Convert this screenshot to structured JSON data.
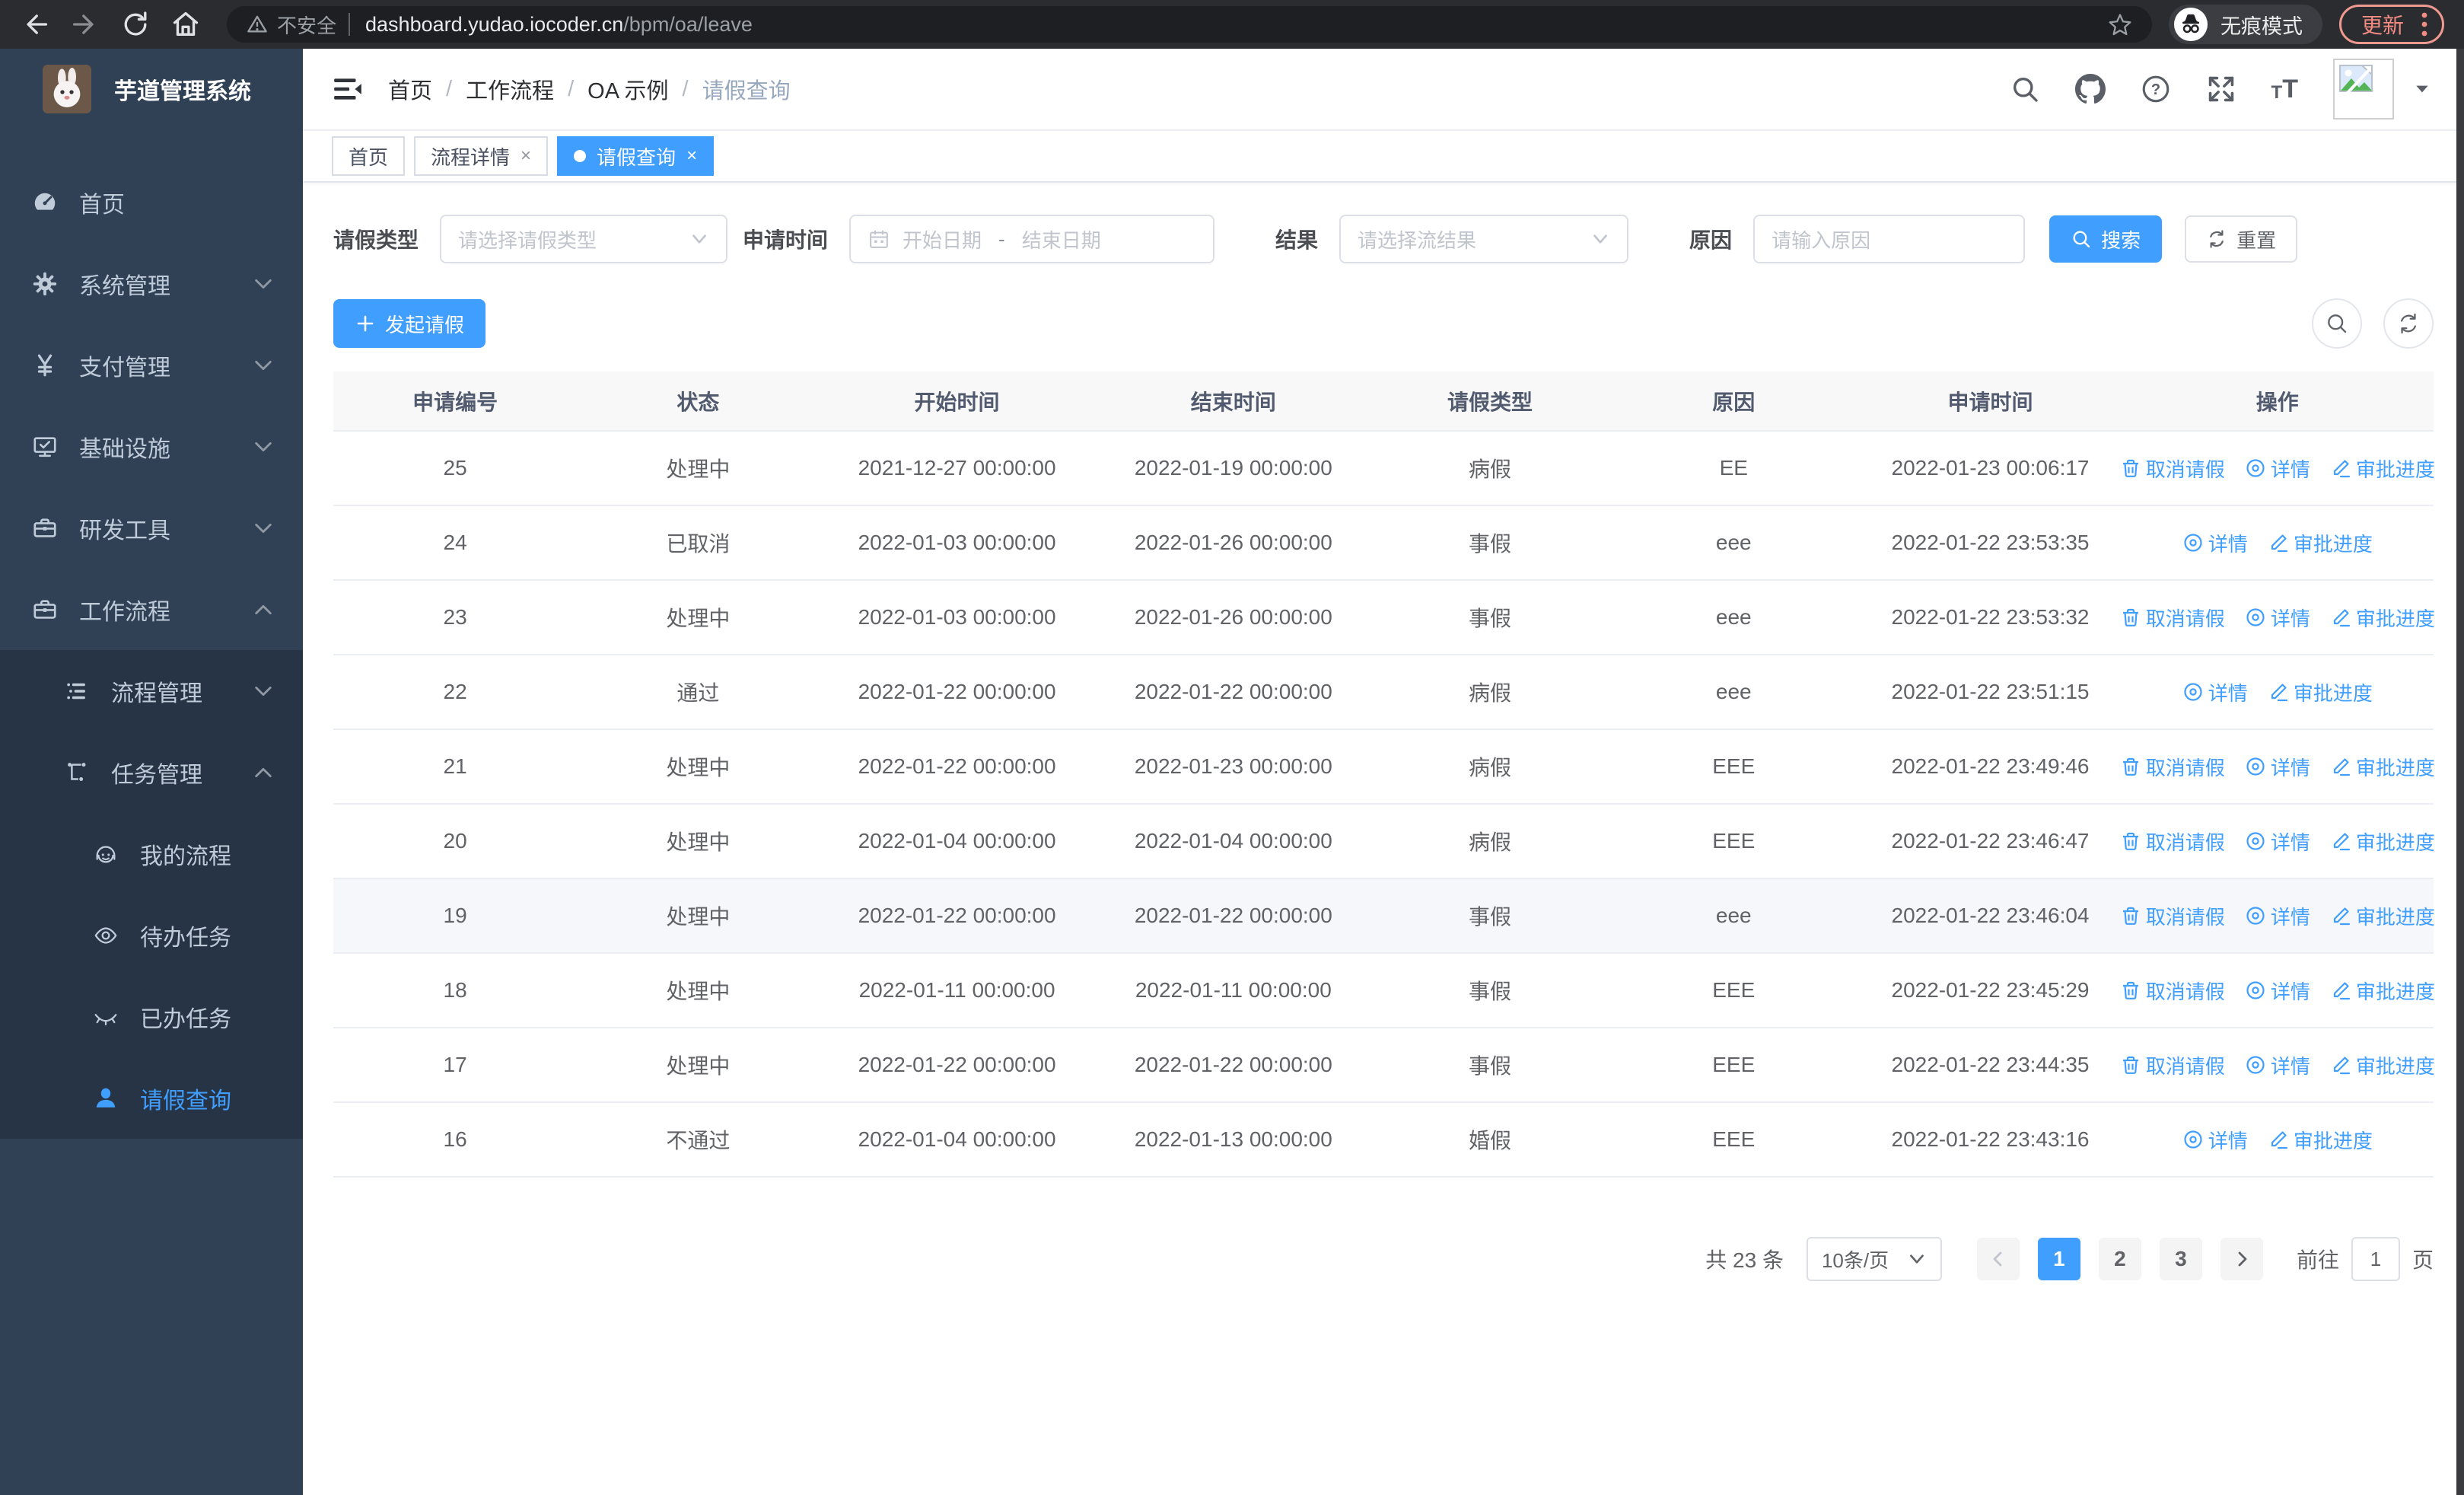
{
  "accent_color": "#409eff",
  "browser": {
    "security_label": "不安全",
    "url_host": "dashboard.yudao.iocoder.cn",
    "url_path": "/bpm/oa/leave",
    "incognito_label": "无痕模式",
    "update_label": "更新"
  },
  "sidebar": {
    "title": "芋道管理系统",
    "items": [
      {
        "label": "首页",
        "icon": "dashboard-icon",
        "level": 1,
        "chevron": "",
        "submenu": false,
        "active": false
      },
      {
        "label": "系统管理",
        "icon": "gear-icon",
        "level": 1,
        "chevron": "down",
        "submenu": false,
        "active": false
      },
      {
        "label": "支付管理",
        "icon": "yen-icon",
        "level": 1,
        "chevron": "down",
        "submenu": false,
        "active": false
      },
      {
        "label": "基础设施",
        "icon": "monitor-icon",
        "level": 1,
        "chevron": "down",
        "submenu": false,
        "active": false
      },
      {
        "label": "研发工具",
        "icon": "toolbox-icon",
        "level": 1,
        "chevron": "down",
        "submenu": false,
        "active": false
      },
      {
        "label": "工作流程",
        "icon": "briefcase-icon",
        "level": 1,
        "chevron": "up",
        "submenu": false,
        "active": false
      },
      {
        "label": "流程管理",
        "icon": "flow-list-icon",
        "level": 2,
        "chevron": "down",
        "submenu": true,
        "active": false
      },
      {
        "label": "任务管理",
        "icon": "tasks-icon",
        "level": 2,
        "chevron": "up",
        "submenu": true,
        "active": false
      },
      {
        "label": "我的流程",
        "icon": "face-icon",
        "level": 3,
        "chevron": "",
        "submenu": true,
        "active": false
      },
      {
        "label": "待办任务",
        "icon": "eye-open-icon",
        "level": 3,
        "chevron": "",
        "submenu": true,
        "active": false
      },
      {
        "label": "已办任务",
        "icon": "eye-closed-icon",
        "level": 3,
        "chevron": "",
        "submenu": true,
        "active": false
      },
      {
        "label": "请假查询",
        "icon": "user-icon",
        "level": 3,
        "chevron": "",
        "submenu": true,
        "active": true
      }
    ]
  },
  "breadcrumb": [
    "首页",
    "工作流程",
    "OA 示例",
    "请假查询"
  ],
  "tabs": [
    {
      "label": "首页",
      "closable": false,
      "active": false
    },
    {
      "label": "流程详情",
      "closable": true,
      "active": false
    },
    {
      "label": "请假查询",
      "closable": true,
      "active": true
    }
  ],
  "filters": {
    "type_label": "请假类型",
    "type_placeholder": "请选择请假类型",
    "time_label": "申请时间",
    "start_placeholder": "开始日期",
    "range_separator": "-",
    "end_placeholder": "结束日期",
    "result_label": "结果",
    "result_placeholder": "请选择流结果",
    "reason_label": "原因",
    "reason_placeholder": "请输入原因",
    "search_label": "搜索",
    "reset_label": "重置"
  },
  "toolbar": {
    "create_label": "发起请假"
  },
  "table": {
    "columns": [
      "申请编号",
      "状态",
      "开始时间",
      "结束时间",
      "请假类型",
      "原因",
      "申请时间",
      "操作"
    ],
    "action_labels": {
      "cancel": "取消请假",
      "detail": "详情",
      "progress": "审批进度"
    },
    "rows": [
      {
        "id": "25",
        "status": "处理中",
        "start": "2021-12-27 00:00:00",
        "end": "2022-01-19 00:00:00",
        "type": "病假",
        "reason": "EE",
        "applied": "2022-01-23 00:06:17",
        "actions": [
          "cancel",
          "detail",
          "progress"
        ],
        "highlight": false
      },
      {
        "id": "24",
        "status": "已取消",
        "start": "2022-01-03 00:00:00",
        "end": "2022-01-26 00:00:00",
        "type": "事假",
        "reason": "eee",
        "applied": "2022-01-22 23:53:35",
        "actions": [
          "detail",
          "progress"
        ],
        "highlight": false
      },
      {
        "id": "23",
        "status": "处理中",
        "start": "2022-01-03 00:00:00",
        "end": "2022-01-26 00:00:00",
        "type": "事假",
        "reason": "eee",
        "applied": "2022-01-22 23:53:32",
        "actions": [
          "cancel",
          "detail",
          "progress"
        ],
        "highlight": false
      },
      {
        "id": "22",
        "status": "通过",
        "start": "2022-01-22 00:00:00",
        "end": "2022-01-22 00:00:00",
        "type": "病假",
        "reason": "eee",
        "applied": "2022-01-22 23:51:15",
        "actions": [
          "detail",
          "progress"
        ],
        "highlight": false
      },
      {
        "id": "21",
        "status": "处理中",
        "start": "2022-01-22 00:00:00",
        "end": "2022-01-23 00:00:00",
        "type": "病假",
        "reason": "EEE",
        "applied": "2022-01-22 23:49:46",
        "actions": [
          "cancel",
          "detail",
          "progress"
        ],
        "highlight": false
      },
      {
        "id": "20",
        "status": "处理中",
        "start": "2022-01-04 00:00:00",
        "end": "2022-01-04 00:00:00",
        "type": "病假",
        "reason": "EEE",
        "applied": "2022-01-22 23:46:47",
        "actions": [
          "cancel",
          "detail",
          "progress"
        ],
        "highlight": false
      },
      {
        "id": "19",
        "status": "处理中",
        "start": "2022-01-22 00:00:00",
        "end": "2022-01-22 00:00:00",
        "type": "事假",
        "reason": "eee",
        "applied": "2022-01-22 23:46:04",
        "actions": [
          "cancel",
          "detail",
          "progress"
        ],
        "highlight": true
      },
      {
        "id": "18",
        "status": "处理中",
        "start": "2022-01-11 00:00:00",
        "end": "2022-01-11 00:00:00",
        "type": "事假",
        "reason": "EEE",
        "applied": "2022-01-22 23:45:29",
        "actions": [
          "cancel",
          "detail",
          "progress"
        ],
        "highlight": false
      },
      {
        "id": "17",
        "status": "处理中",
        "start": "2022-01-22 00:00:00",
        "end": "2022-01-22 00:00:00",
        "type": "事假",
        "reason": "EEE",
        "applied": "2022-01-22 23:44:35",
        "actions": [
          "cancel",
          "detail",
          "progress"
        ],
        "highlight": false
      },
      {
        "id": "16",
        "status": "不通过",
        "start": "2022-01-04 00:00:00",
        "end": "2022-01-13 00:00:00",
        "type": "婚假",
        "reason": "EEE",
        "applied": "2022-01-22 23:43:16",
        "actions": [
          "detail",
          "progress"
        ],
        "highlight": false
      }
    ]
  },
  "pagination": {
    "total_label": "共 23 条",
    "page_size_label": "10条/页",
    "pages": [
      "1",
      "2",
      "3"
    ],
    "current_page": "1",
    "goto_label": "前往",
    "goto_value": "1",
    "unit_label": "页"
  }
}
